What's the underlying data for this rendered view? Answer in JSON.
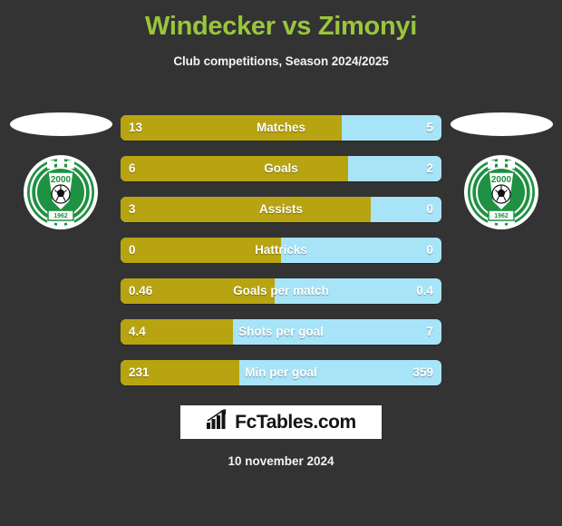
{
  "header": {
    "title": "Windecker vs Zimonyi",
    "subtitle": "Club competitions, Season 2024/2025"
  },
  "colors": {
    "background": "#333333",
    "title": "#9ac63b",
    "home_bar": "#b8a411",
    "away_bar": "#a8e4f8",
    "text": "#ffffff",
    "crest_green": "#1e9142"
  },
  "teams": {
    "home": {
      "crest_year": "2000",
      "crest_banner": "1962",
      "flag": "flag-placeholder"
    },
    "away": {
      "crest_year": "2000",
      "crest_banner": "1962",
      "flag": "flag-placeholder"
    }
  },
  "footer": {
    "brand_text": "FcTables.com",
    "brand_icon": "bar-chart-arrow-icon",
    "date": "10 november 2024"
  },
  "chart_data": {
    "type": "bar",
    "title": "Windecker vs Zimonyi",
    "subtitle": "Club competitions, Season 2024/2025",
    "orientation": "horizontal-diverging",
    "legend": [
      "Windecker",
      "Zimonyi"
    ],
    "categories": [
      "Matches",
      "Goals",
      "Assists",
      "Hattricks",
      "Goals per match",
      "Shots per goal",
      "Min per goal"
    ],
    "series": [
      {
        "name": "Windecker",
        "color": "#b8a411",
        "values": [
          13,
          6,
          3,
          0,
          0.46,
          4.4,
          231
        ]
      },
      {
        "name": "Zimonyi",
        "color": "#a8e4f8",
        "values": [
          5,
          2,
          0,
          0,
          0.4,
          7,
          359
        ]
      }
    ],
    "rows": [
      {
        "label": "Matches",
        "home": "13",
        "away": "5",
        "home_pct": 69
      },
      {
        "label": "Goals",
        "home": "6",
        "away": "2",
        "home_pct": 71
      },
      {
        "label": "Assists",
        "home": "3",
        "away": "0",
        "home_pct": 78
      },
      {
        "label": "Hattricks",
        "home": "0",
        "away": "0",
        "home_pct": 50
      },
      {
        "label": "Goals per match",
        "home": "0.46",
        "away": "0.4",
        "home_pct": 48
      },
      {
        "label": "Shots per goal",
        "home": "4.4",
        "away": "7",
        "home_pct": 35
      },
      {
        "label": "Min per goal",
        "home": "231",
        "away": "359",
        "home_pct": 37
      }
    ],
    "grid": false,
    "date": "10 november 2024"
  }
}
